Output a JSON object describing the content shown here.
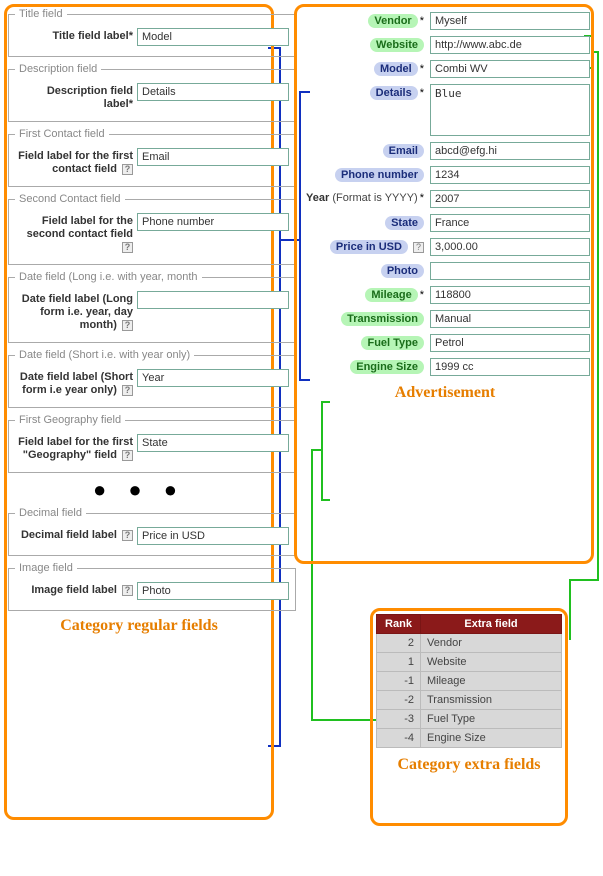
{
  "left": {
    "caption": "Category regular fields",
    "groups": [
      {
        "legend": "Title field",
        "label": "Title field label",
        "ast": "*",
        "help": false,
        "value": "Model"
      },
      {
        "legend": "Description field",
        "label": "Description field label",
        "ast": "*",
        "help": false,
        "value": "Details"
      },
      {
        "legend": "First Contact field",
        "label": "Field label for the first contact field",
        "ast": "",
        "help": true,
        "value": "Email"
      },
      {
        "legend": "Second Contact field",
        "label": "Field label for the second contact field",
        "ast": "",
        "help": true,
        "value": "Phone number"
      },
      {
        "legend": "Date field (Long i.e. with year, month",
        "label": "Date field label (Long form i.e. year, day month)",
        "ast": "",
        "help": true,
        "value": ""
      },
      {
        "legend": "Date field (Short i.e. with year only)",
        "label": "Date field label (Short form i.e year only)",
        "ast": "",
        "help": true,
        "value": "Year"
      },
      {
        "legend": "First Geography field",
        "label": "Field label for the first \"Geography\" field",
        "ast": "",
        "help": true,
        "value": "State"
      },
      {
        "legend": "Decimal field",
        "label": "Decimal field label",
        "ast": "",
        "help": true,
        "value": "Price in USD"
      },
      {
        "legend": "Image field",
        "label": "Image field label",
        "ast": "",
        "help": true,
        "value": "Photo"
      }
    ]
  },
  "right": {
    "caption": "Advertisement",
    "fields": [
      {
        "label": "Vendor",
        "style": "green",
        "ast": "*",
        "help": false,
        "type": "text",
        "value": "Myself"
      },
      {
        "label": "Website",
        "style": "green",
        "ast": "",
        "help": false,
        "type": "text",
        "value": "http://www.abc.de"
      },
      {
        "label": "Model",
        "style": "blue",
        "ast": "*",
        "help": false,
        "type": "text",
        "value": "Combi WV"
      },
      {
        "label": "Details",
        "style": "blue",
        "ast": "*",
        "help": false,
        "type": "textarea",
        "value": "Blue"
      },
      {
        "label": "Email",
        "style": "blue",
        "ast": "",
        "help": false,
        "type": "text",
        "value": "abcd@efg.hi"
      },
      {
        "label": "Phone number",
        "style": "blue",
        "ast": "",
        "help": false,
        "type": "text",
        "value": "1234"
      },
      {
        "label": "Year",
        "style": "plain",
        "suffix": " (Format is YYYY)",
        "ast": "*",
        "help": false,
        "type": "text",
        "value": "2007"
      },
      {
        "label": "State",
        "style": "blue",
        "ast": "",
        "help": false,
        "type": "text",
        "value": "France"
      },
      {
        "label": "Price in USD",
        "style": "blue",
        "ast": "",
        "help": true,
        "type": "text",
        "value": "3,000.00"
      },
      {
        "label": "Photo",
        "style": "blue",
        "ast": "",
        "help": false,
        "type": "text",
        "value": ""
      },
      {
        "label": "Mileage",
        "style": "green",
        "ast": "*",
        "help": false,
        "type": "text",
        "value": "118800"
      },
      {
        "label": "Transmission",
        "style": "green",
        "ast": "",
        "help": false,
        "type": "text",
        "value": "Manual"
      },
      {
        "label": "Fuel Type",
        "style": "green",
        "ast": "",
        "help": false,
        "type": "text",
        "value": "Petrol"
      },
      {
        "label": "Engine Size",
        "style": "green",
        "ast": "",
        "help": false,
        "type": "text",
        "value": "1999 cc"
      }
    ]
  },
  "table": {
    "caption": "Category extra fields",
    "headers": [
      "Rank",
      "Extra field"
    ],
    "rows": [
      {
        "rank": "2",
        "name": "Vendor"
      },
      {
        "rank": "1",
        "name": "Website"
      },
      {
        "rank": "-1",
        "name": "Mileage"
      },
      {
        "rank": "-2",
        "name": "Transmission"
      },
      {
        "rank": "-3",
        "name": "Fuel Type"
      },
      {
        "rank": "-4",
        "name": "Engine Size"
      }
    ]
  },
  "dots": "● ● ●"
}
